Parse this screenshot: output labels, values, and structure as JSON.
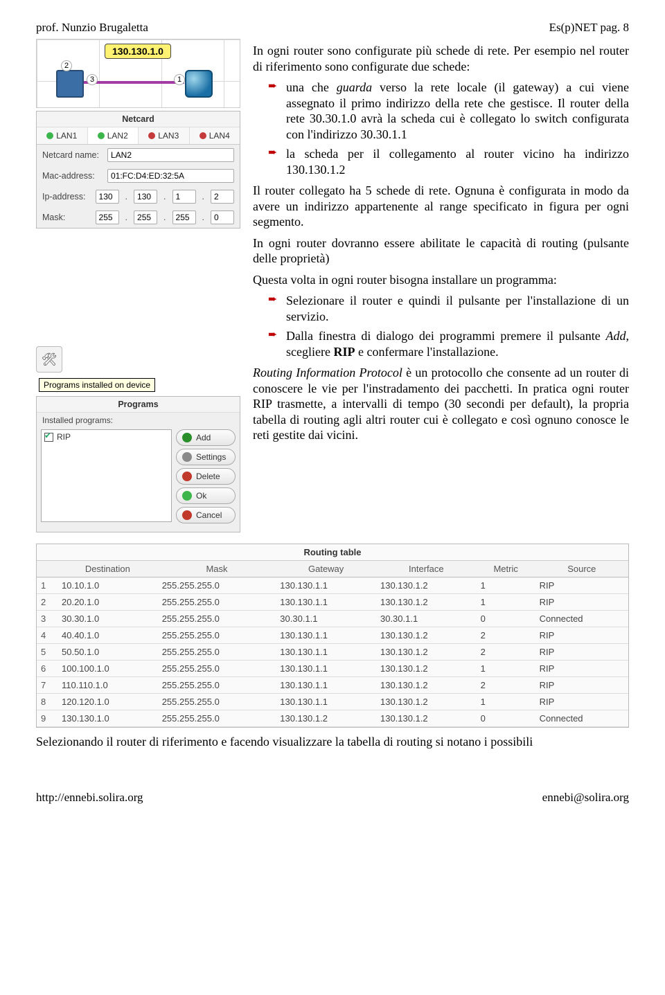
{
  "header": {
    "left": "prof. Nunzio Brugaletta",
    "right": "Es(p)NET pag. 8"
  },
  "diagram": {
    "ip_label": "130.130.1.0"
  },
  "netcard": {
    "title": "Netcard",
    "tabs": [
      {
        "label": "LAN1",
        "state": "g"
      },
      {
        "label": "LAN2",
        "state": "g"
      },
      {
        "label": "LAN3",
        "state": "r"
      },
      {
        "label": "LAN4",
        "state": "r"
      }
    ],
    "labels": {
      "name": "Netcard name:",
      "mac": "Mac-address:",
      "ip": "Ip-address:",
      "mask": "Mask:"
    },
    "name_value": "LAN2",
    "mac_value": "01:FC:D4:ED:32:5A",
    "ip": [
      "130",
      "130",
      "1",
      "2"
    ],
    "mask": [
      "255",
      "255",
      "255",
      "0"
    ]
  },
  "tooltip": {
    "text": "Programs installed on device"
  },
  "programs": {
    "title": "Programs",
    "installed_label": "Installed programs:",
    "item": "RIP",
    "buttons": {
      "add": "Add",
      "settings": "Settings",
      "delete": "Delete",
      "ok": "Ok",
      "cancel": "Cancel"
    }
  },
  "text": {
    "p1": "In ogni router sono configurate più schede di rete. Per esempio nel router di riferimento sono configurate due schede:",
    "b1": "una che guarda verso la rete locale (il gateway) a cui viene assegnato il primo indirizzo della rete che gestisce. Il router della rete 30.30.1.0 avrà la scheda cui è collegato lo switch configurata con l'indirizzo 30.30.1.1",
    "b2": "la scheda per il collegamento al router vicino ha indirizzo 130.130.1.2",
    "p2": "Il router collegato ha 5 schede di rete. Ognuna è configurata in modo da avere un indirizzo appartenente al range specificato in figura per ogni segmento.",
    "p3": "In ogni router dovranno essere abilitate le capacità di routing (pulsante delle proprietà)",
    "p4": "Questa volta in ogni router bisogna installare un programma:",
    "b3": "Selezionare il router e quindi il pulsante per l'installazione di un servizio.",
    "b4": "Dalla finestra di dialogo dei programmi premere il pulsante Add, scegliere RIP e confermare l'installazione.",
    "p5": "Routing Information Protocol è un protocollo che consente ad un router di conoscere le vie per l'instradamento dei pacchetti. In pratica ogni router RIP trasmette, a intervalli di tempo (30 secondi per default), la propria tabella di routing agli altri router cui è collegato e così ognuno conosce le reti gestite dai vicini."
  },
  "rtable": {
    "title": "Routing table",
    "headers": [
      "",
      "Destination",
      "Mask",
      "Gateway",
      "Interface",
      "Metric",
      "Source"
    ],
    "rows": [
      [
        "1",
        "10.10.1.0",
        "255.255.255.0",
        "130.130.1.1",
        "130.130.1.2",
        "1",
        "RIP"
      ],
      [
        "2",
        "20.20.1.0",
        "255.255.255.0",
        "130.130.1.1",
        "130.130.1.2",
        "1",
        "RIP"
      ],
      [
        "3",
        "30.30.1.0",
        "255.255.255.0",
        "30.30.1.1",
        "30.30.1.1",
        "0",
        "Connected"
      ],
      [
        "4",
        "40.40.1.0",
        "255.255.255.0",
        "130.130.1.1",
        "130.130.1.2",
        "2",
        "RIP"
      ],
      [
        "5",
        "50.50.1.0",
        "255.255.255.0",
        "130.130.1.1",
        "130.130.1.2",
        "2",
        "RIP"
      ],
      [
        "6",
        "100.100.1.0",
        "255.255.255.0",
        "130.130.1.1",
        "130.130.1.2",
        "1",
        "RIP"
      ],
      [
        "7",
        "110.110.1.0",
        "255.255.255.0",
        "130.130.1.1",
        "130.130.1.2",
        "2",
        "RIP"
      ],
      [
        "8",
        "120.120.1.0",
        "255.255.255.0",
        "130.130.1.1",
        "130.130.1.2",
        "1",
        "RIP"
      ],
      [
        "9",
        "130.130.1.0",
        "255.255.255.0",
        "130.130.1.2",
        "130.130.1.2",
        "0",
        "Connected"
      ]
    ]
  },
  "endline": "Selezionando il router di riferimento e facendo visualizzare la tabella di routing si notano i possibili",
  "footer": {
    "left": "http://ennebi.solira.org",
    "right": "ennebi@solira.org"
  }
}
